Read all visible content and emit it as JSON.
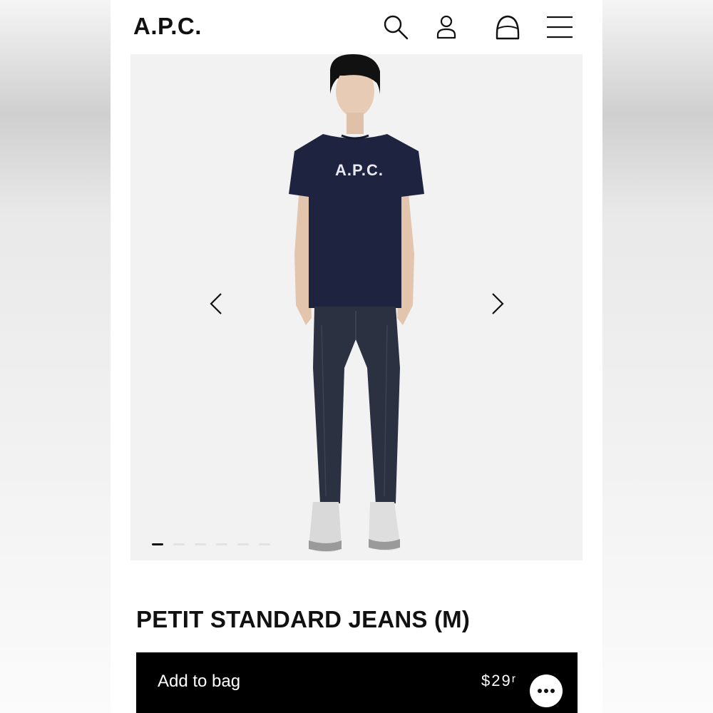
{
  "header": {
    "logo": "A.P.C.",
    "icons": [
      "search-icon",
      "account-icon",
      "bag-icon",
      "menu-icon"
    ]
  },
  "gallery": {
    "image_count": 6,
    "active_index": 0,
    "shirt_print": "A.P.C.",
    "controls": [
      "chevron-left-icon",
      "chevron-right-icon"
    ]
  },
  "product": {
    "title": "PETIT STANDARD JEANS (M)",
    "add_to_bag_label": "Add to bag",
    "price": "$29ʳ"
  },
  "chat": {
    "icon": "chat-icon"
  },
  "colors": {
    "background": "#ffffff",
    "gallery_bg": "#f3f2f3",
    "button_bg": "#000000",
    "text": "#111111",
    "shirt": "#1e2340",
    "denim": "#2b3140"
  }
}
